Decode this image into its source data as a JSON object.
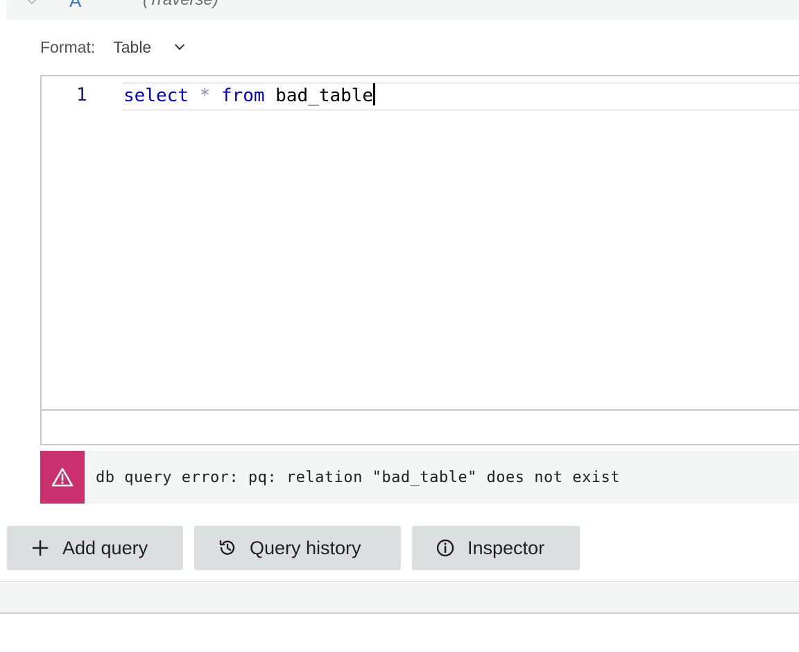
{
  "query_header": {
    "ref": "A",
    "subtitle": "(Traverse)"
  },
  "format": {
    "label": "Format:",
    "value": "Table"
  },
  "editor": {
    "line_number": "1",
    "code": {
      "kw1": "select",
      "op": "*",
      "kw2": "from",
      "ident": "bad_table"
    }
  },
  "error": {
    "message": "db query error: pq: relation \"bad_table\" does not exist"
  },
  "actions": {
    "add_query": "Add query",
    "query_history": "Query history",
    "inspector": "Inspector"
  },
  "colors": {
    "error_accent": "#c9306d",
    "keyword": "#0000d6"
  },
  "icons": {
    "add": "plus-icon",
    "history": "history-icon",
    "inspector": "info-icon",
    "error": "warning-icon",
    "dropdown": "chevron-down-icon"
  }
}
